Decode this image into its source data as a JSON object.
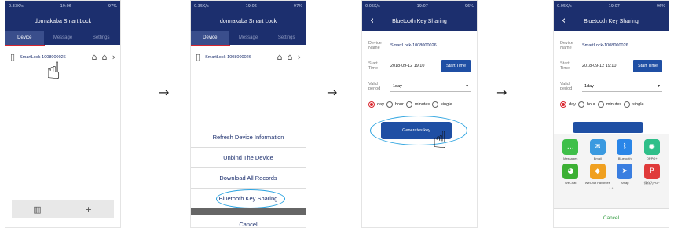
{
  "screen1": {
    "status_left": "0.33K/s",
    "status_time": "19:06",
    "status_right": "97%",
    "title": "dormakaba Smart Lock",
    "tabs": [
      "Device",
      "Message",
      "Settings"
    ],
    "device_name": "SmartLock-1008000026",
    "bottom_add": "+"
  },
  "arrows": [
    "→",
    "→",
    "→"
  ],
  "screen2": {
    "status_left": "0.35K/s",
    "status_time": "19:06",
    "status_right": "97%",
    "title": "dormakaba Smart Lock",
    "tabs": [
      "Device",
      "Message",
      "Settings"
    ],
    "device_name": "SmartLock-1008000026",
    "menu": [
      "Refresh Device Information",
      "Unbind The Device",
      "Download All Records",
      "Bluetooth Key Sharing"
    ],
    "cancel": "Cancel"
  },
  "screen3": {
    "status_left": "0.05K/s",
    "status_time": "19:07",
    "status_right": "96%",
    "title": "Bluetooth Key Sharing",
    "device_label": "Device Name",
    "device_value": "SmartLock-1008000026",
    "start_label": "Start Time",
    "start_value": "2018-09-12 19:10",
    "start_button": "Start Time",
    "valid_label": "Valid period",
    "valid_value": "1day",
    "radio_options": [
      "day",
      "hour",
      "minutes",
      "single"
    ],
    "generate_button": "Generates key"
  },
  "screen4": {
    "status_left": "0.05K/s",
    "status_time": "19:07",
    "status_right": "96%",
    "title": "Bluetooth Key Sharing",
    "device_label": "Device Name",
    "device_value": "SmartLock-1008000026",
    "start_label": "Start Time",
    "start_value": "2018-09-12 19:10",
    "start_button": "Start Time",
    "valid_label": "Valid period",
    "valid_value": "1day",
    "radio_options": [
      "day",
      "hour",
      "minutes",
      "single"
    ],
    "share_apps": [
      {
        "label": "Messages",
        "color": "#3fbf4a",
        "icon": "message-icon"
      },
      {
        "label": "Email",
        "color": "#3a9ae0",
        "icon": "email-icon"
      },
      {
        "label": "Bluetooth",
        "color": "#2a86e8",
        "icon": "bluetooth-icon"
      },
      {
        "label": "OPPO+",
        "color": "#2fbf8a",
        "icon": "oppo-icon"
      },
      {
        "label": "WeChat",
        "color": "#3cb034",
        "icon": "wechat-icon"
      },
      {
        "label": "WeChat Favorites",
        "color": "#f0a020",
        "icon": "cube-icon"
      },
      {
        "label": "Amap",
        "color": "#3a7ee0",
        "icon": "map-icon"
      },
      {
        "label": "保存为PDF",
        "color": "#e03a3a",
        "icon": "pdf-icon"
      }
    ],
    "cancel": "Cancel"
  },
  "colors": {
    "header": "#1c2f6e",
    "accent_red": "#d9262e",
    "button_blue": "#1f4fa4",
    "highlight": "#2ba3e0",
    "share_cancel": "#2f9a3d"
  }
}
